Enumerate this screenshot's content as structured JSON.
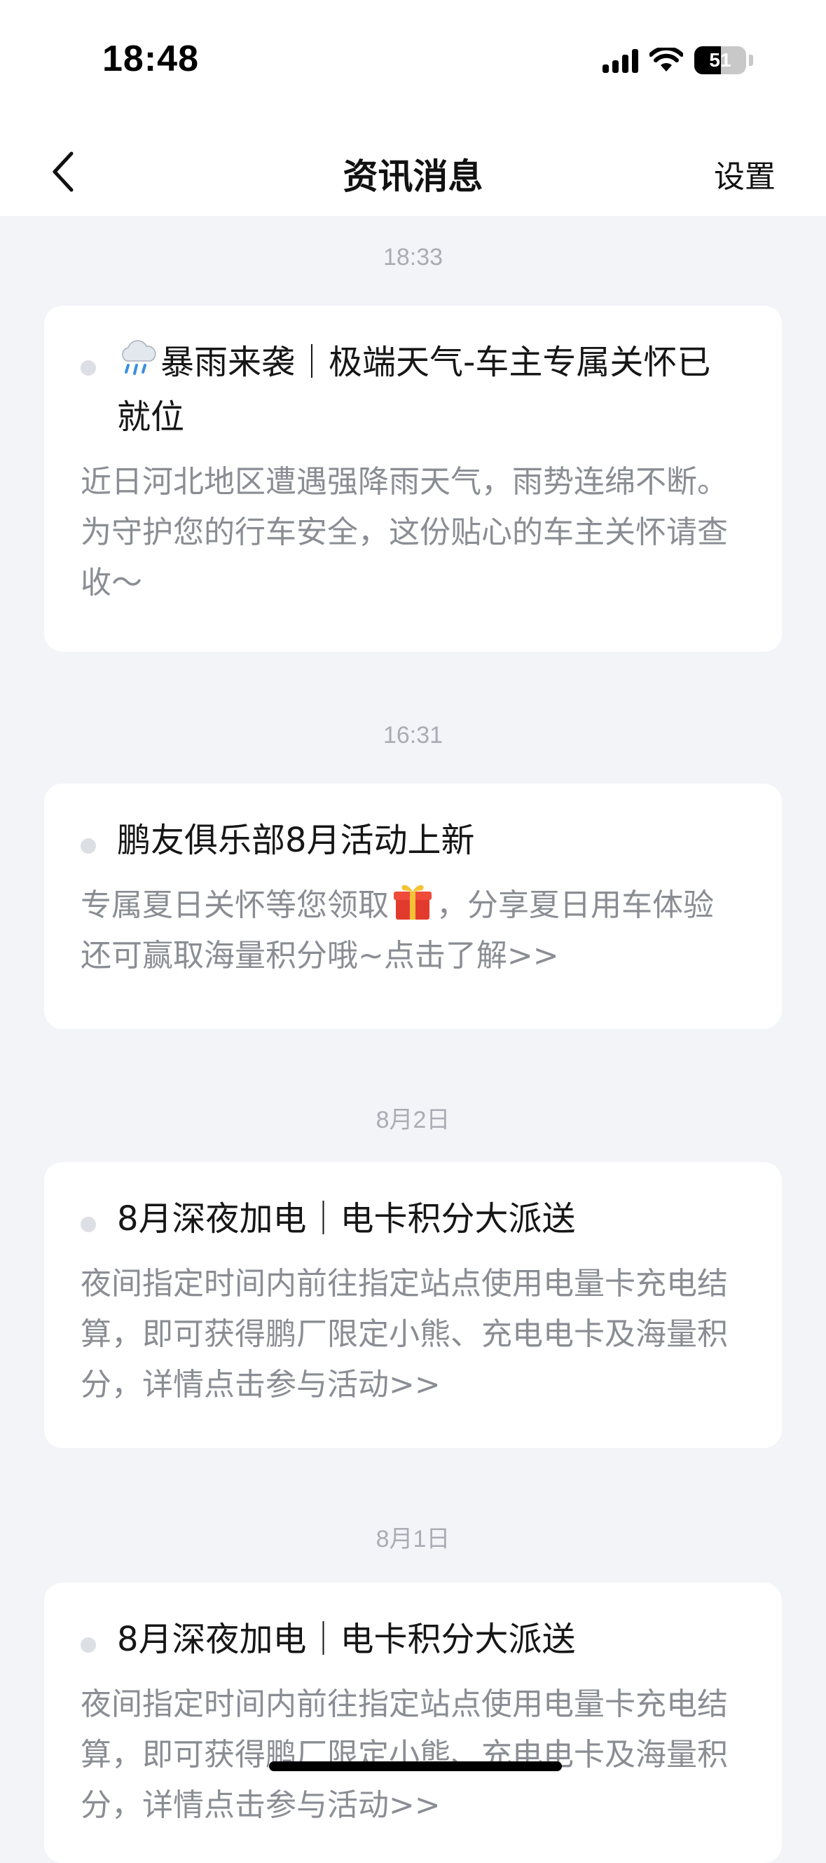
{
  "status_bar": {
    "time": "18:48",
    "battery": "51",
    "battery_level": 0.51,
    "icons": [
      "signal-icon",
      "wifi-icon",
      "battery-icon"
    ]
  },
  "nav": {
    "back_icon": "chevron-left-icon",
    "title": "资讯消息",
    "settings_label": "设置"
  },
  "messages": [
    {
      "time": "18:33",
      "title_emoji": "rain-cloud-icon",
      "title": "暴雨来袭｜极端天气-车主专属关怀已就位",
      "body": "近日河北地区遭遇强降雨天气，雨势连绵不断。为守护您的行车安全，这份贴心的车主关怀请查收～"
    },
    {
      "time": "16:31",
      "title": "鹏友俱乐部8月活动上新",
      "body_before": "专属夏日关怀等您领取",
      "body_emoji": "gift-icon",
      "body_after": "，分享夏日用车体验还可赢取海量积分哦~点击了解>>"
    },
    {
      "time": "8月2日",
      "title": "8月深夜加电｜电卡积分大派送",
      "body": "夜间指定时间内前往指定站点使用电量卡充电结算，即可获得鹏厂限定小熊、充电电卡及海量积分，详情点击参与活动>>"
    },
    {
      "time": "8月1日",
      "title": "8月深夜加电｜电卡积分大派送",
      "body": "夜间指定时间内前往指定站点使用电量卡充电结算，即可获得鹏厂限定小熊、充电电卡及海量积分，详情点击参与活动>>"
    }
  ],
  "colors": {
    "background": "#f2f4f8",
    "card": "#ffffff",
    "title_text": "#161616",
    "body_text": "#8a8d93",
    "timestamp": "#a9adb3",
    "unread_dot": "#dcdfe4"
  }
}
